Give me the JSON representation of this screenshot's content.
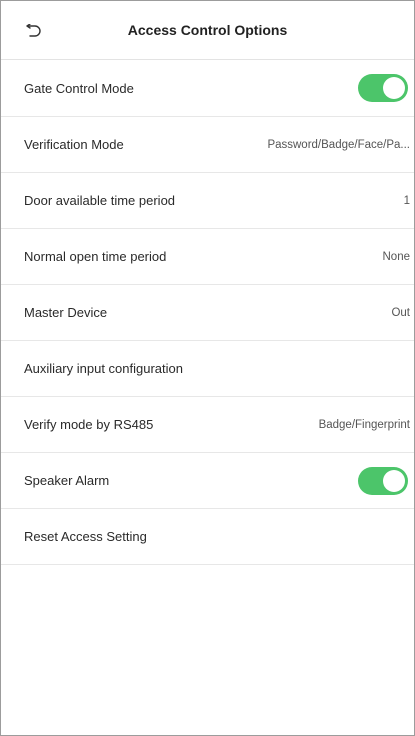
{
  "header": {
    "title": "Access Control Options"
  },
  "rows": [
    {
      "label": "Gate Control Mode",
      "type": "toggle",
      "checked": true
    },
    {
      "label": "Verification Mode",
      "type": "value",
      "value": "Password/Badge/Face/Pa..."
    },
    {
      "label": "Door available time period",
      "type": "value",
      "value": "1"
    },
    {
      "label": "Normal open time period",
      "type": "value",
      "value": "None"
    },
    {
      "label": "Master Device",
      "type": "value",
      "value": "Out"
    },
    {
      "label": "Auxiliary input configuration",
      "type": "none"
    },
    {
      "label": "Verify mode by RS485",
      "type": "value",
      "value": "Badge/Fingerprint"
    },
    {
      "label": "Speaker Alarm",
      "type": "toggle",
      "checked": true
    },
    {
      "label": "Reset Access Setting",
      "type": "none"
    }
  ],
  "colors": {
    "toggle_on": "#4cc56a",
    "divider": "#e7e7e7"
  },
  "icons": {
    "back": "back-arrow-icon"
  }
}
